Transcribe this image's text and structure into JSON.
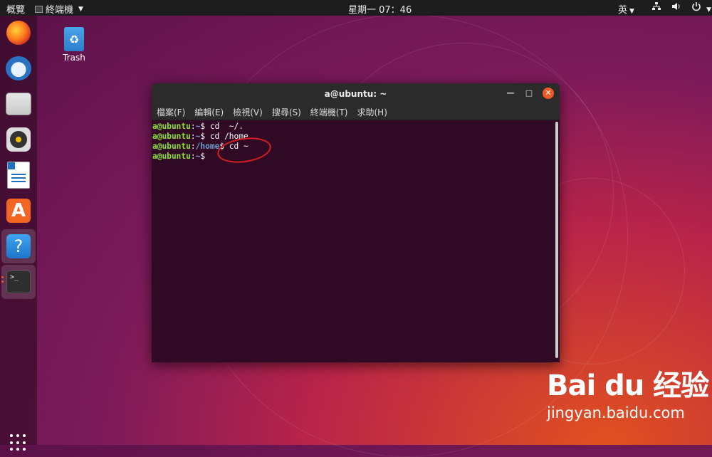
{
  "topbar": {
    "activities": "概覽",
    "app_menu": "終端機",
    "clock": "星期一 07：46",
    "ime": "英"
  },
  "dock": {
    "items": [
      "firefox-icon",
      "thunderbird-icon",
      "files-icon",
      "rhythmbox-icon",
      "writer-icon",
      "software-icon",
      "help-icon",
      "terminal-icon"
    ],
    "terminal_glyph": ">_"
  },
  "desktop": {
    "trash_label": "Trash"
  },
  "window": {
    "title": "a@ubuntu: ~",
    "menu": [
      "檔案(F)",
      "編輯(E)",
      "檢視(V)",
      "搜尋(S)",
      "終端機(T)",
      "求助(H)"
    ],
    "lines": [
      {
        "user": "a@ubuntu",
        "sep": ":",
        "path": "~",
        "cmd": "$ cd  ~/."
      },
      {
        "user": "a@ubuntu",
        "sep": ":",
        "path": "~",
        "cmd": "$ cd /home"
      },
      {
        "user": "a@ubuntu",
        "sep": ":",
        "path": "/home",
        "cmd": "$ cd ~"
      },
      {
        "user": "a@ubuntu",
        "sep": ":",
        "path": "~",
        "cmd": "$"
      }
    ]
  },
  "watermark": {
    "logo": "Bai du 经验",
    "url": "jingyan.baidu.com"
  },
  "colors": {
    "prompt_user": "#8ae234",
    "prompt_path": "#729fcf",
    "terminal_bg": "#300a24",
    "annotation": "#d81e1e"
  }
}
